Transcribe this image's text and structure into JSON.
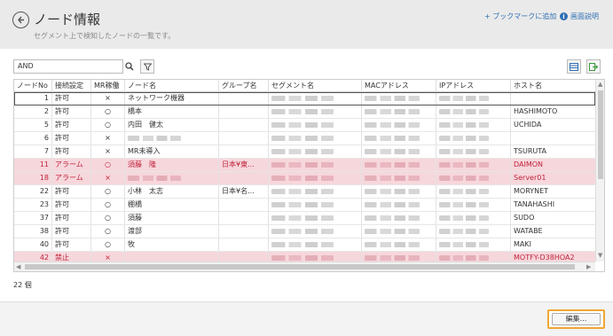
{
  "header": {
    "title": "ノード情報",
    "subtitle": "セグメント上で検知したノードの一覧です。",
    "bookmark_label": "+ ブックマークに追加",
    "help_label": "画面説明"
  },
  "toolbar": {
    "search_value": "AND"
  },
  "table": {
    "columns": [
      "ノードNo",
      "接続設定",
      "MR稼働",
      "ノード名",
      "グループ名",
      "セグメント名",
      "MACアドレス",
      "IPアドレス",
      "ホスト名"
    ],
    "rows": [
      {
        "no": "1",
        "conn": "許可",
        "mr": "×",
        "name": "ネットワーク機器",
        "group": "",
        "host": "",
        "status": "normal",
        "redacted_name": false
      },
      {
        "no": "2",
        "conn": "許可",
        "mr": "○",
        "name": "橋本",
        "group": "",
        "host": "HASHIMOTO",
        "status": "normal",
        "redacted_name": false
      },
      {
        "no": "5",
        "conn": "許可",
        "mr": "○",
        "name": "内田　健太",
        "group": "",
        "host": "UCHIDA",
        "status": "normal",
        "redacted_name": false
      },
      {
        "no": "6",
        "conn": "許可",
        "mr": "×",
        "name": "",
        "group": "",
        "host": "",
        "status": "normal",
        "redacted_name": true
      },
      {
        "no": "7",
        "conn": "許可",
        "mr": "×",
        "name": "MR未導入",
        "group": "",
        "host": "TSURUTA",
        "status": "normal",
        "redacted_name": false
      },
      {
        "no": "11",
        "conn": "アラーム",
        "mr": "○",
        "name": "須藤　隆",
        "group": "日本¥東...",
        "host": "DAIMON",
        "status": "alarm",
        "redacted_name": false
      },
      {
        "no": "18",
        "conn": "アラーム",
        "mr": "×",
        "name": "",
        "group": "",
        "host": "Server01",
        "status": "alarm",
        "redacted_name": true
      },
      {
        "no": "22",
        "conn": "許可",
        "mr": "○",
        "name": "小林　太志",
        "group": "日本¥名...",
        "host": "MORYNET",
        "status": "normal",
        "redacted_name": false
      },
      {
        "no": "23",
        "conn": "許可",
        "mr": "○",
        "name": "棚橋",
        "group": "",
        "host": "TANAHASHI",
        "status": "normal",
        "redacted_name": false
      },
      {
        "no": "37",
        "conn": "許可",
        "mr": "○",
        "name": "須藤",
        "group": "",
        "host": "SUDO",
        "status": "normal",
        "redacted_name": false
      },
      {
        "no": "38",
        "conn": "許可",
        "mr": "○",
        "name": "渡部",
        "group": "",
        "host": "WATABE",
        "status": "normal",
        "redacted_name": false
      },
      {
        "no": "40",
        "conn": "許可",
        "mr": "○",
        "name": "牧",
        "group": "",
        "host": "MAKI",
        "status": "normal",
        "redacted_name": false
      },
      {
        "no": "42",
        "conn": "禁止",
        "mr": "×",
        "name": "",
        "group": "",
        "host": "MOTFY-D38HOA2",
        "status": "alarm",
        "redacted_name": false
      }
    ]
  },
  "count_label": "22 個",
  "footer": {
    "edit_label": "編集..."
  },
  "colors": {
    "alarm_bg": "#f6d7dc",
    "alarm_text": "#c0233a",
    "link": "#2f6fb3",
    "focus_border": "#f0a733"
  }
}
